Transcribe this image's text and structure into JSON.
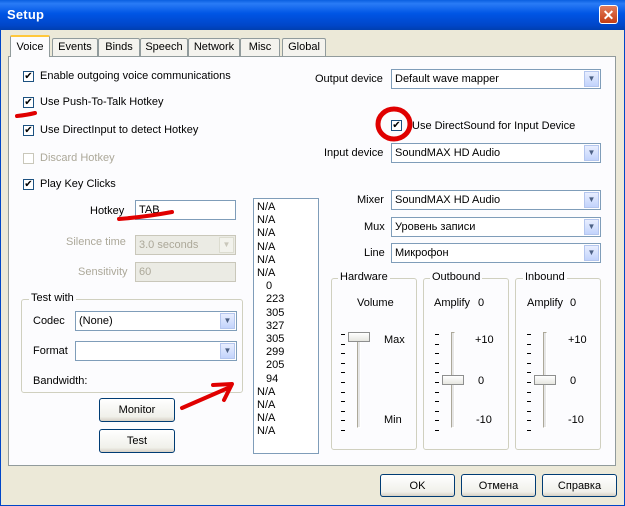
{
  "window": {
    "title": "Setup",
    "close_symbol": "✕"
  },
  "tabs": [
    "Voice",
    "Events",
    "Binds",
    "Speech",
    "Network",
    "Misc",
    "Global"
  ],
  "voice": {
    "checks": {
      "enable_outgoing": "Enable outgoing voice communications",
      "push_to_talk": "Use Push-To-Talk Hotkey",
      "direct_input": "Use DirectInput to detect Hotkey",
      "discard_hotkey": "Discard Hotkey",
      "play_key_clicks": "Play Key Clicks",
      "direct_sound": "Use DirectSound for Input Device"
    },
    "checked_mark": "✔",
    "hotkey_label": "Hotkey",
    "hotkey_value": "TAB",
    "silence_label": "Silence time",
    "silence_value": "3.0 seconds",
    "sensitivity_label": "Sensitivity",
    "sensitivity_value": "60",
    "test_with": {
      "title": "Test with",
      "codec_label": "Codec",
      "codec_value": "(None)",
      "format_label": "Format",
      "format_value": "",
      "bandwidth_label": "Bandwidth:"
    },
    "monitor_button": "Monitor",
    "test_button": "Test",
    "list_values": [
      "N/A",
      "N/A",
      "N/A",
      "N/A",
      "N/A",
      "N/A",
      "0",
      "223",
      "305",
      "327",
      "305",
      "299",
      "205",
      "94",
      "N/A",
      "N/A",
      "N/A",
      "N/A"
    ],
    "output_device_label": "Output device",
    "output_device_value": "Default wave mapper",
    "input_device_label": "Input device",
    "input_device_value": "SoundMAX HD Audio",
    "mixer_label": "Mixer",
    "mixer_value": "SoundMAX HD Audio",
    "mux_label": "Mux",
    "mux_value": "Уровень записи",
    "line_label": "Line",
    "line_value": "Микрофон",
    "hardware": {
      "title": "Hardware",
      "caption": "Volume",
      "max": "Max",
      "min": "Min",
      "level": 1.0
    },
    "outbound": {
      "title": "Outbound",
      "caption": "Amplify",
      "value": "0",
      "top": "+10",
      "mid": "0",
      "bottom": "-10",
      "level": 0.5
    },
    "inbound": {
      "title": "Inbound",
      "caption": "Amplify",
      "value": "0",
      "top": "+10",
      "mid": "0",
      "bottom": "-10",
      "level": 0.5
    }
  },
  "footer": {
    "ok": "OK",
    "cancel": "Отмена",
    "help": "Справка"
  },
  "colors": {
    "annotation": "#e00000",
    "title_bar": "#0055e5"
  }
}
